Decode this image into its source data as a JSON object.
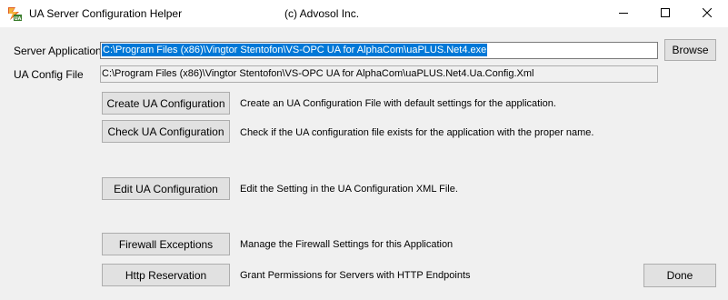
{
  "window": {
    "title": "UA Server Configuration Helper",
    "company": "(c) Advosol Inc.",
    "icon": "ua-app-icon",
    "controls": {
      "minimize_icon": "minimize-icon",
      "maximize_icon": "maximize-icon",
      "close_icon": "close-icon"
    }
  },
  "form": {
    "server_application": {
      "label": "Server Application",
      "value": "C:\\Program Files (x86)\\Vingtor Stentofon\\VS-OPC UA for AlphaCom\\uaPLUS.Net4.exe"
    },
    "browse_label": "Browse",
    "ua_config_file": {
      "label": "UA Config File",
      "value": "C:\\Program Files (x86)\\Vingtor Stentofon\\VS-OPC UA for AlphaCom\\uaPLUS.Net4.Ua.Config.Xml"
    }
  },
  "actions": [
    {
      "label": "Create UA Configuration",
      "description": "Create an UA Configuration File with default settings for the application."
    },
    {
      "label": "Check UA Configuration",
      "description": "Check if the UA configuration file exists for the application with the proper name."
    },
    {
      "label": "Edit UA Configuration",
      "description": "Edit the Setting in the UA Configuration XML File."
    },
    {
      "label": "Firewall Exceptions",
      "description": "Manage the Firewall Settings for this Application"
    },
    {
      "label": "Http Reservation",
      "description": "Grant Permissions for Servers with HTTP Endpoints"
    }
  ],
  "done_label": "Done",
  "colors": {
    "selection": "#0078d7",
    "button_face": "#e1e1e1",
    "window_bg": "#f0f0f0"
  }
}
